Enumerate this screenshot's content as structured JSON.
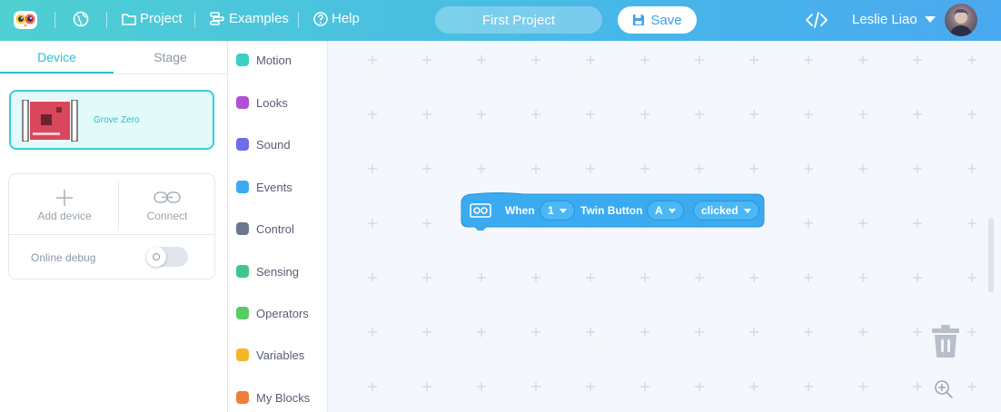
{
  "header": {
    "project_label": "Project",
    "examples_label": "Examples",
    "help_label": "Help",
    "project_title": "First Project",
    "save_label": "Save",
    "user_name": "Leslie Liao"
  },
  "left_panel": {
    "tabs": [
      "Device",
      "Stage"
    ],
    "device_name": "Grove Zero",
    "add_device_label": "Add device",
    "connect_label": "Connect",
    "online_debug_label": "Online debug",
    "online_debug_on": false
  },
  "categories": [
    {
      "label": "Motion",
      "color": "#3bd0c4"
    },
    {
      "label": "Looks",
      "color": "#b14fd9"
    },
    {
      "label": "Sound",
      "color": "#6d6ce9"
    },
    {
      "label": "Events",
      "color": "#3aabf0"
    },
    {
      "label": "Control",
      "color": "#6b7790"
    },
    {
      "label": "Sensing",
      "color": "#3fc58e"
    },
    {
      "label": "Operators",
      "color": "#57cc63"
    },
    {
      "label": "Variables",
      "color": "#f4b62a"
    },
    {
      "label": "My Blocks",
      "color": "#f27d3a"
    }
  ],
  "block": {
    "when_label": "When",
    "number_value": "1",
    "twin_button_label": "Twin Button",
    "button_value": "A",
    "action_value": "clicked",
    "color": "#3aabf0"
  }
}
